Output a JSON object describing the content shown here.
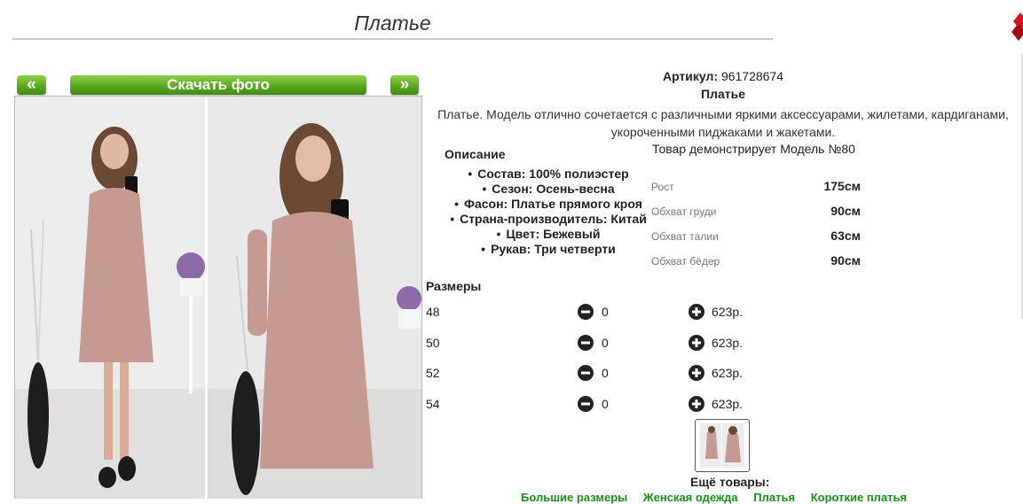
{
  "page": {
    "title": "Платье"
  },
  "nav": {
    "prev": "«",
    "next": "»",
    "download": "Скачать фото"
  },
  "product": {
    "sku_label": "Артикул:",
    "sku": "961728674",
    "name": "Платье",
    "description_line1": "Платье. Модель отлично сочетается с различными яркими аксессуарами, жилетами, кардиганами,",
    "description_line2": "укороченными пиджаками и жакетами."
  },
  "specs": {
    "title": "Описание",
    "items": [
      "Состав: 100% полиэстер",
      "Сезон: Осень-весна",
      "Фасон: Платье прямого кроя",
      "Страна-производитель: Китай",
      "Цвет: Бежевый",
      "Рукав: Три четверти"
    ]
  },
  "model": {
    "title": "Товар демонстрирует Модель №80",
    "measures": [
      {
        "label": "Рост",
        "value": "175см"
      },
      {
        "label": "Обхват груди",
        "value": "90см"
      },
      {
        "label": "Обхват талии",
        "value": "63см"
      },
      {
        "label": "Обхват бёдер",
        "value": "90см"
      }
    ]
  },
  "sizes": {
    "title": "Размеры",
    "rows": [
      {
        "size": "48",
        "qty": "0",
        "price": "623р."
      },
      {
        "size": "50",
        "qty": "0",
        "price": "623р."
      },
      {
        "size": "52",
        "qty": "0",
        "price": "623р."
      },
      {
        "size": "54",
        "qty": "0",
        "price": "623р."
      }
    ]
  },
  "more": {
    "title": "Ещё товары:",
    "links": [
      "Большие размеры",
      "Женская одежда",
      "Платья",
      "Короткие платья"
    ]
  },
  "icons": {
    "minus": "minus-circle-icon",
    "plus": "plus-circle-icon"
  },
  "colors": {
    "button_green": "#5ba81f",
    "link_green": "#1a8f1a",
    "corner_red": "#d8141b",
    "dress": "#c49a92"
  }
}
